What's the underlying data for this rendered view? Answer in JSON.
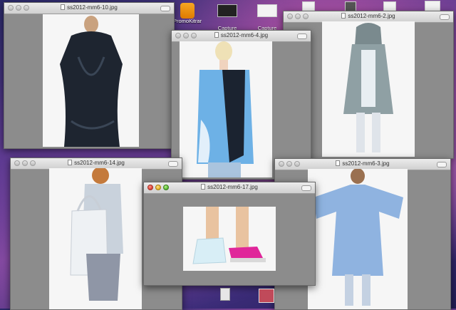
{
  "desktop": {
    "icons": [
      {
        "label": "PromoKitrar",
        "type": "app"
      },
      {
        "label": "Capture",
        "type": "screenshot"
      },
      {
        "label": "Capture",
        "type": "screenshot"
      }
    ]
  },
  "windows": [
    {
      "title": "ss2012-mm6-10.jpg",
      "active": false
    },
    {
      "title": "ss2012-mm6-4.jpg",
      "active": false
    },
    {
      "title": "ss2012-mm6-2.jpg",
      "active": false
    },
    {
      "title": "ss2012-mm6-14.jpg",
      "active": false
    },
    {
      "title": "ss2012-mm6-17.jpg",
      "active": true
    },
    {
      "title": "ss2012-mm6-3.jpg",
      "active": false
    }
  ],
  "colors": {
    "window_gray": "#8c8c8c",
    "photo_bg": "#f6f6f6",
    "sky_blue": "#6db1e6",
    "pink_strap": "#e0269a"
  }
}
